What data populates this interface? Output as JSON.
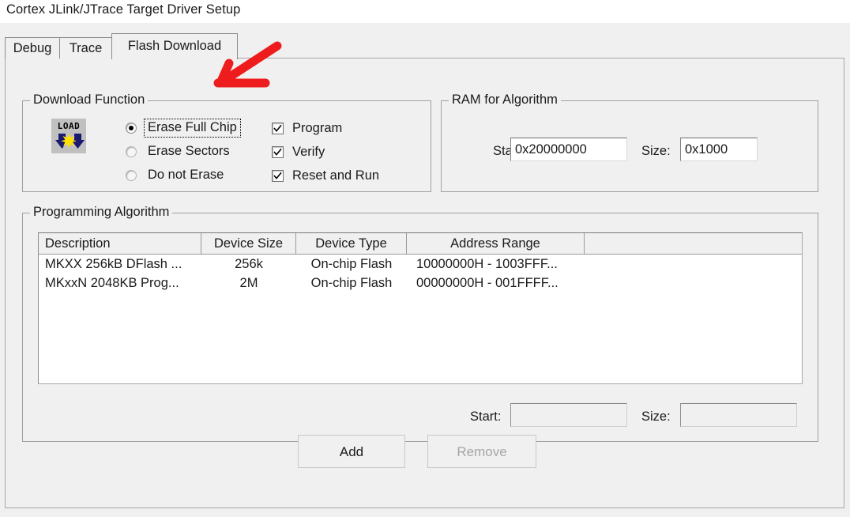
{
  "window": {
    "title": "Cortex JLink/JTrace Target Driver Setup"
  },
  "tabs": [
    {
      "label": "Debug",
      "active": false
    },
    {
      "label": "Trace",
      "active": false
    },
    {
      "label": "Flash Download",
      "active": true
    }
  ],
  "download_function": {
    "legend": "Download Function",
    "icon_text": "LOAD",
    "radios": [
      {
        "label": "Erase Full Chip",
        "selected": true,
        "focused": true
      },
      {
        "label": "Erase Sectors",
        "selected": false,
        "focused": false
      },
      {
        "label": "Do not Erase",
        "selected": false,
        "focused": false
      }
    ],
    "checkboxes": [
      {
        "label": "Program",
        "checked": true
      },
      {
        "label": "Verify",
        "checked": true
      },
      {
        "label": "Reset and Run",
        "checked": true
      }
    ]
  },
  "ram_for_algorithm": {
    "legend": "RAM for Algorithm",
    "start_label": "Start:",
    "start_value": "0x20000000",
    "size_label": "Size:",
    "size_value": "0x1000"
  },
  "programming_algorithm": {
    "legend": "Programming Algorithm",
    "columns": [
      "Description",
      "Device Size",
      "Device Type",
      "Address Range",
      ""
    ],
    "rows": [
      {
        "description": "MKXX 256kB DFlash ...",
        "device_size": "256k",
        "device_type": "On-chip Flash",
        "address_range": "10000000H - 1003FFF...",
        "extra": ""
      },
      {
        "description": "MKxxN 2048KB Prog...",
        "device_size": "2M",
        "device_type": "On-chip Flash",
        "address_range": "00000000H - 001FFFF...",
        "extra": ""
      }
    ],
    "start_label": "Start:",
    "start_value": "",
    "size_label": "Size:",
    "size_value": ""
  },
  "buttons": {
    "add": "Add",
    "remove": "Remove"
  },
  "annotation": {
    "arrow_color": "#ee1c1c"
  }
}
